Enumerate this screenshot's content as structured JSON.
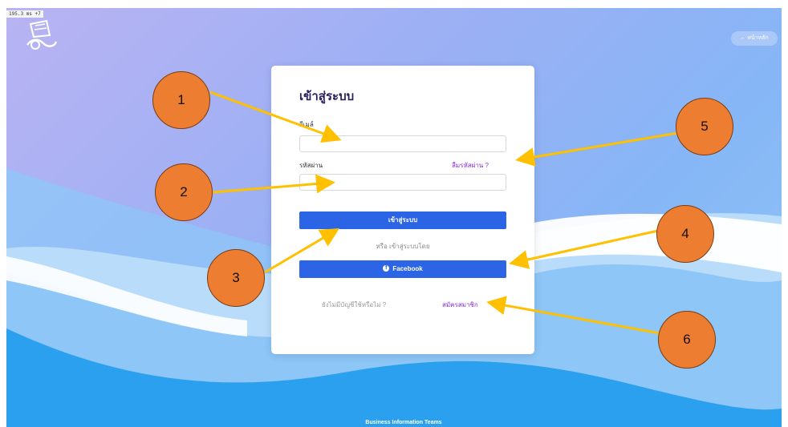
{
  "debug": {
    "zoom_text": "195.3 ms +7"
  },
  "header": {
    "home_button_label": "← หน้าหลัก"
  },
  "login": {
    "title": "เข้าสู่ระบบ",
    "email_label": "อีเมล์",
    "email_value": "",
    "password_label": "รหัสผ่าน",
    "password_value": "",
    "forgot_link": "ลืมรหัสผ่าน ?",
    "submit_label": "เข้าสู่ระบบ",
    "or_text": "หรือ เข้าสู่ระบบโดย",
    "facebook_label": "Facebook",
    "no_account_text": "ยังไม่มีบัญชีใช้หรือไม่ ?",
    "signup_link": "สมัครสมาชิก"
  },
  "footer": {
    "text": "Business Information Teams"
  },
  "annotations": {
    "markers": [
      {
        "label": "1"
      },
      {
        "label": "2"
      },
      {
        "label": "3"
      },
      {
        "label": "4"
      },
      {
        "label": "5"
      },
      {
        "label": "6"
      }
    ],
    "marker_color": "#ed7d31",
    "arrow_color": "#ffc000"
  },
  "colors": {
    "primary_button": "#2c64e6",
    "link": "#8a2bd8",
    "title": "#2a1d5c"
  },
  "icons": [
    "ship-logo-icon",
    "facebook-icon",
    "arrow-left-icon"
  ]
}
